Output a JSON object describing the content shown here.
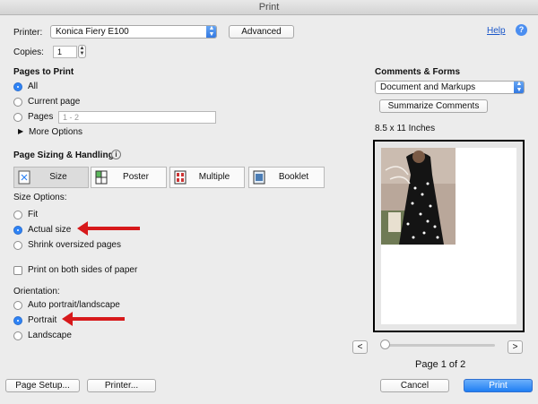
{
  "window": {
    "title": "Print"
  },
  "printer": {
    "label": "Printer:",
    "value": "Konica Fiery E100",
    "advanced_label": "Advanced"
  },
  "help": {
    "label": "Help",
    "icon": "question-icon"
  },
  "copies": {
    "label": "Copies:",
    "value": "1"
  },
  "pages_to_print": {
    "heading": "Pages to Print",
    "all": "All",
    "current_page": "Current page",
    "pages": "Pages",
    "pages_placeholder": "1 - 2",
    "more_options": "More Options",
    "selected": "All"
  },
  "sizing": {
    "heading": "Page Sizing & Handling",
    "tabs": [
      "Size",
      "Poster",
      "Multiple",
      "Booklet"
    ],
    "active_tab": "Size",
    "size_options_label": "Size Options:",
    "fit": "Fit",
    "actual_size": "Actual size",
    "shrink": "Shrink oversized pages",
    "selected": "Actual size"
  },
  "duplex": {
    "label": "Print on both sides of paper",
    "checked": false
  },
  "orientation": {
    "label": "Orientation:",
    "auto": "Auto portrait/landscape",
    "portrait": "Portrait",
    "landscape": "Landscape",
    "selected": "Portrait"
  },
  "comments_forms": {
    "heading": "Comments & Forms",
    "value": "Document and Markups",
    "summarize_label": "Summarize Comments"
  },
  "preview": {
    "paper_size": "8.5 x 11 Inches",
    "page_indicator": "Page 1 of 2",
    "prev_label": "<",
    "next_label": ">",
    "slider_position": 0
  },
  "footer": {
    "page_setup": "Page Setup...",
    "printer": "Printer...",
    "cancel": "Cancel",
    "print": "Print"
  },
  "colors": {
    "accent": "#2f83f5",
    "annotation_arrow": "#d7191b"
  }
}
